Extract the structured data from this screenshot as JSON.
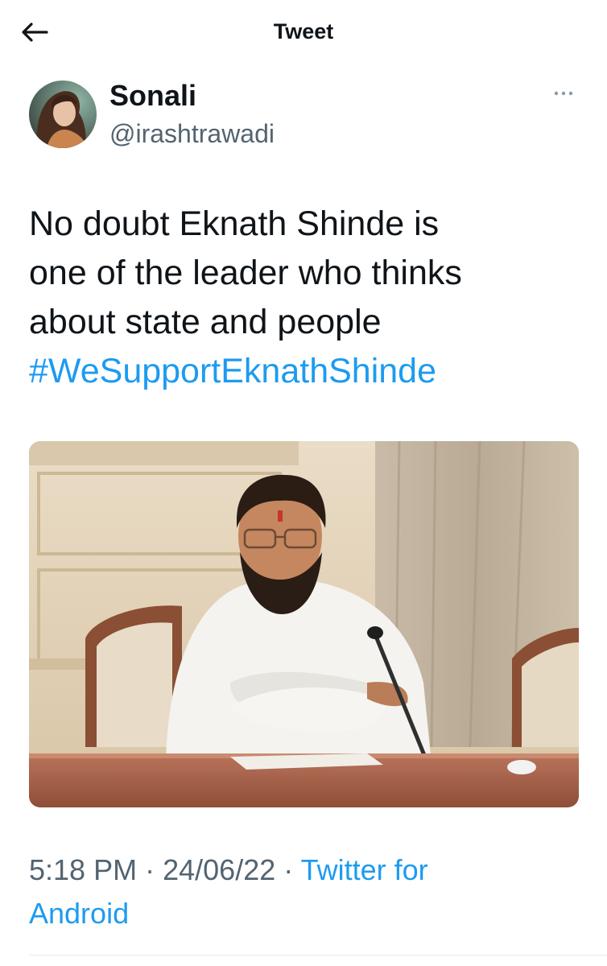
{
  "header": {
    "title": "Tweet",
    "back_icon": "arrow-left-icon"
  },
  "author": {
    "display_name": "Sonali",
    "handle": "@irashtrawadi",
    "avatar_icon": "avatar"
  },
  "tweet": {
    "text_lines": [
      "No doubt Eknath Shinde is",
      "one of the leader who thinks",
      "about state and people"
    ],
    "hashtag": "#WeSupportEknathShinde",
    "media_description": "photo"
  },
  "meta": {
    "time": "5:18 PM",
    "separator": "·",
    "date": "24/06/22",
    "source_line1": "Twitter for",
    "source_line2": "Android"
  },
  "colors": {
    "accent": "#1d9bf0",
    "text": "#0f1419",
    "secondary": "#536471"
  }
}
